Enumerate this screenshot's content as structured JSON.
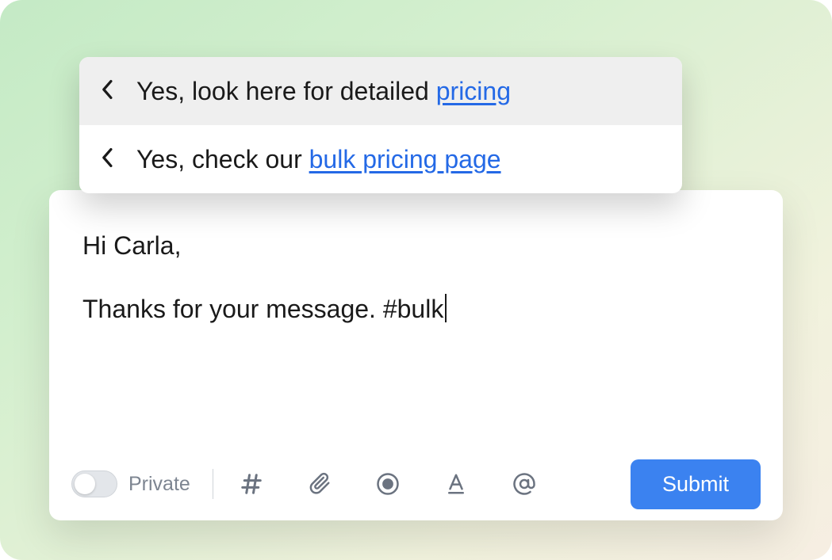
{
  "suggestions": [
    {
      "prefix": "Yes, look here for detailed ",
      "link": "pricing",
      "highlighted": true
    },
    {
      "prefix": "Yes, check our ",
      "link": "bulk pricing page",
      "highlighted": false
    }
  ],
  "message": {
    "line1": "Hi Carla,",
    "line2_before": "Thanks for your message. ",
    "line2_hash": "#bulk"
  },
  "toolbar": {
    "private_label": "Private",
    "submit_label": "Submit"
  }
}
